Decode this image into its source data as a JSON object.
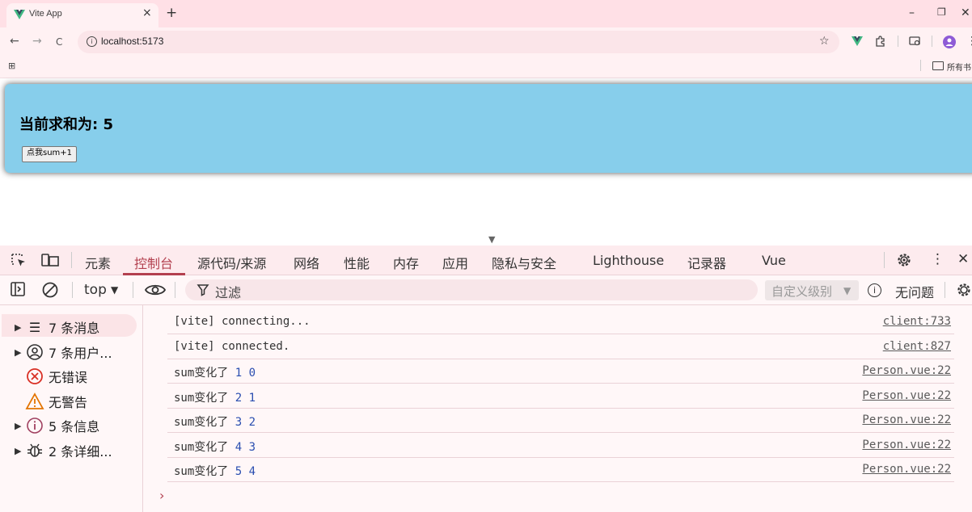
{
  "browser": {
    "tab_title": "Vite App",
    "tab_close": "×",
    "new_tab": "+",
    "window_controls": {
      "minimize": "–",
      "restore": "❐",
      "close": "✕"
    },
    "nav": {
      "back": "←",
      "forward": "→",
      "reload": "C"
    },
    "url": "localhost:5173",
    "bookmarks_label": "所有书",
    "icons": [
      "vue-favicon-icon",
      "info-icon",
      "star-icon",
      "vue-devtools-icon",
      "extensions-icon",
      "cast-icon",
      "profile-icon",
      "menu-icon",
      "apps-icon",
      "folder-icon"
    ]
  },
  "page": {
    "heading": "当前求和为: 5",
    "button_label": "点我sum+1",
    "card_color": "#87ceeb"
  },
  "devtools": {
    "tabs": [
      "元素",
      "控制台",
      "源代码/来源",
      "网络",
      "性能",
      "内存",
      "应用",
      "隐私与安全",
      "Lighthouse",
      "记录器",
      "Vue"
    ],
    "active_tab": "控制台",
    "context": "top",
    "filter_placeholder": "过滤",
    "level_select": "自定义级别",
    "issues_label": "无问题",
    "sidebar": [
      {
        "label": "7 条消息",
        "icon": "list-icon",
        "expandable": true,
        "selected": true
      },
      {
        "label": "7 条用户...",
        "icon": "user-icon",
        "expandable": true,
        "selected": false
      },
      {
        "label": "无错误",
        "icon": "error-icon",
        "expandable": false,
        "selected": false
      },
      {
        "label": "无警告",
        "icon": "warning-icon",
        "expandable": false,
        "selected": false
      },
      {
        "label": "5 条信息",
        "icon": "info-icon",
        "expandable": true,
        "selected": false
      },
      {
        "label": "2 条详细...",
        "icon": "bug-icon",
        "expandable": true,
        "selected": false
      }
    ],
    "logs": [
      {
        "text": "[vite] connecting...",
        "a": "",
        "b": "",
        "source": "client:733"
      },
      {
        "text": "[vite] connected.",
        "a": "",
        "b": "",
        "source": "client:827"
      },
      {
        "text": "sum变化了",
        "a": "1",
        "b": "0",
        "source": "Person.vue:22"
      },
      {
        "text": "sum变化了",
        "a": "2",
        "b": "1",
        "source": "Person.vue:22"
      },
      {
        "text": "sum变化了",
        "a": "3",
        "b": "2",
        "source": "Person.vue:22"
      },
      {
        "text": "sum变化了",
        "a": "4",
        "b": "3",
        "source": "Person.vue:22"
      },
      {
        "text": "sum变化了",
        "a": "5",
        "b": "4",
        "source": "Person.vue:22"
      }
    ],
    "prompt": "›"
  }
}
